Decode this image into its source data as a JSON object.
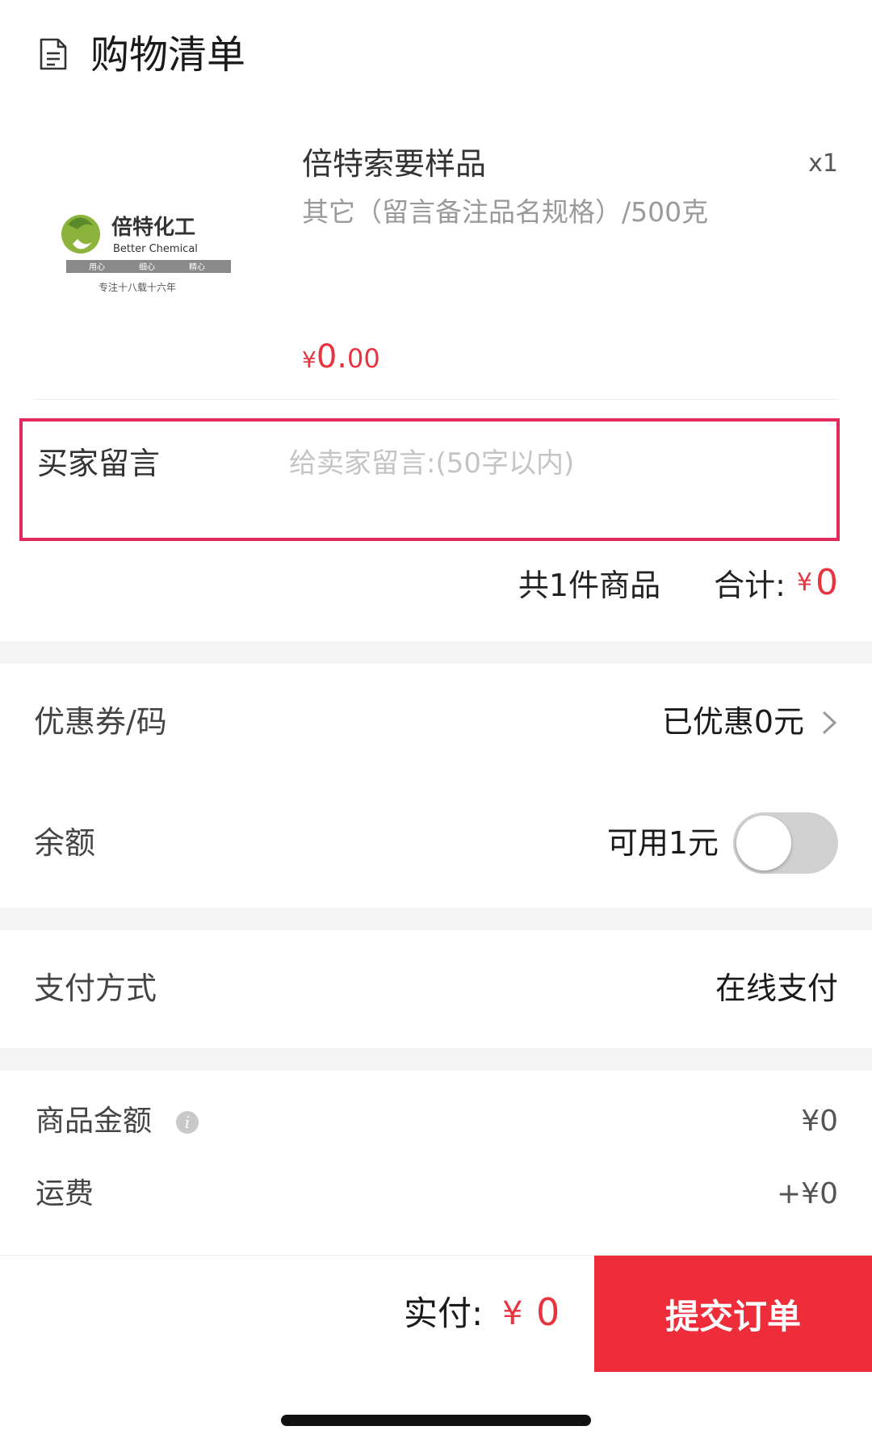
{
  "header": {
    "title": "购物清单",
    "icon": "document-icon"
  },
  "product": {
    "name": "倍特索要样品",
    "spec": "其它（留言备注品名规格）/500克",
    "quantity": "x1",
    "price_symbol": "¥",
    "price_int": "0.",
    "price_dec": "00",
    "logo": {
      "brand_cn": "倍特化工",
      "brand_en": "Better Chemical",
      "mottos": [
        "用心",
        "细心",
        "精心"
      ],
      "tagline": "专注十八载十六年"
    }
  },
  "message": {
    "label": "买家留言",
    "placeholder": "给卖家留言:(50字以内)",
    "value": ""
  },
  "summary": {
    "count_text": "共1件商品",
    "total_label": "合计:",
    "total_symbol": "¥",
    "total_amount": "0"
  },
  "coupon": {
    "label": "优惠券/码",
    "value": "已优惠0元"
  },
  "balance": {
    "label": "余额",
    "value": "可用1元",
    "enabled": false
  },
  "payment": {
    "label": "支付方式",
    "value": "在线支付"
  },
  "fees": [
    {
      "label": "商品金额",
      "value": "¥0"
    },
    {
      "label": "运费",
      "value": "+¥0"
    }
  ],
  "bottom": {
    "pay_label": "实付:",
    "pay_symbol": "¥",
    "pay_amount": "0",
    "submit_label": "提交订单"
  },
  "colors": {
    "accent": "#ef2d3a",
    "price": "#e8343f",
    "highlight_border": "#e22a5d"
  }
}
